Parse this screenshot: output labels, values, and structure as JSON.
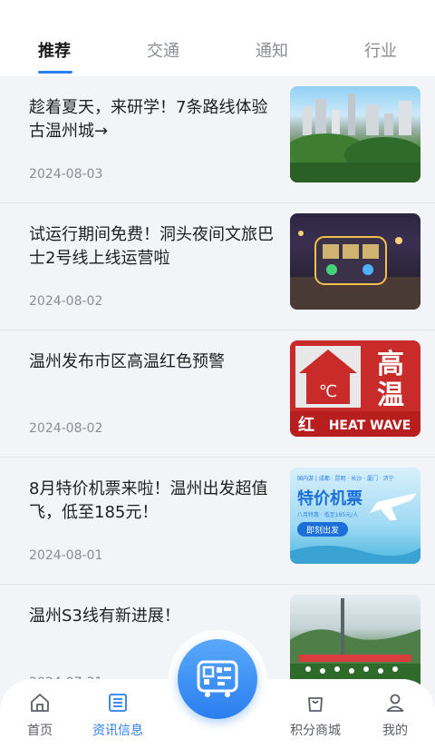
{
  "tabs": [
    {
      "label": "推荐",
      "active": true
    },
    {
      "label": "交通",
      "active": false
    },
    {
      "label": "通知",
      "active": false
    },
    {
      "label": "行业",
      "active": false
    }
  ],
  "news": [
    {
      "title": "趁着夏天，来研学！7条路线体验古温州城→",
      "date": "2024-08-03"
    },
    {
      "title": "试运行期间免费！洞头夜间文旅巴士2号线上线运营啦",
      "date": "2024-08-02"
    },
    {
      "title": "温州发布市区高温红色预警",
      "date": "2024-08-02"
    },
    {
      "title": "8月特价机票来啦！温州出发超值飞，低至185元！",
      "date": "2024-08-01"
    },
    {
      "title": "温州S3线有新进展！",
      "date": "2024-07-31"
    }
  ],
  "thumb_heat": {
    "big1": "高",
    "big2": "温",
    "small": "红",
    "wave": "HEAT WAVE",
    "temp": "℃"
  },
  "thumb_flight": {
    "top": "国内游 | 成都 · 昆明 · 长沙 · 厦门 · 济宁",
    "main": "特价机票",
    "sub": "八月特惠 · 低至185元/人",
    "btn": "即刻出发"
  },
  "bottom_nav": {
    "home": "首页",
    "news": "资讯信息",
    "mall": "积分商城",
    "mine": "我的"
  },
  "colors": {
    "accent": "#2a7ef0",
    "heat_red": "#c92a2a"
  }
}
